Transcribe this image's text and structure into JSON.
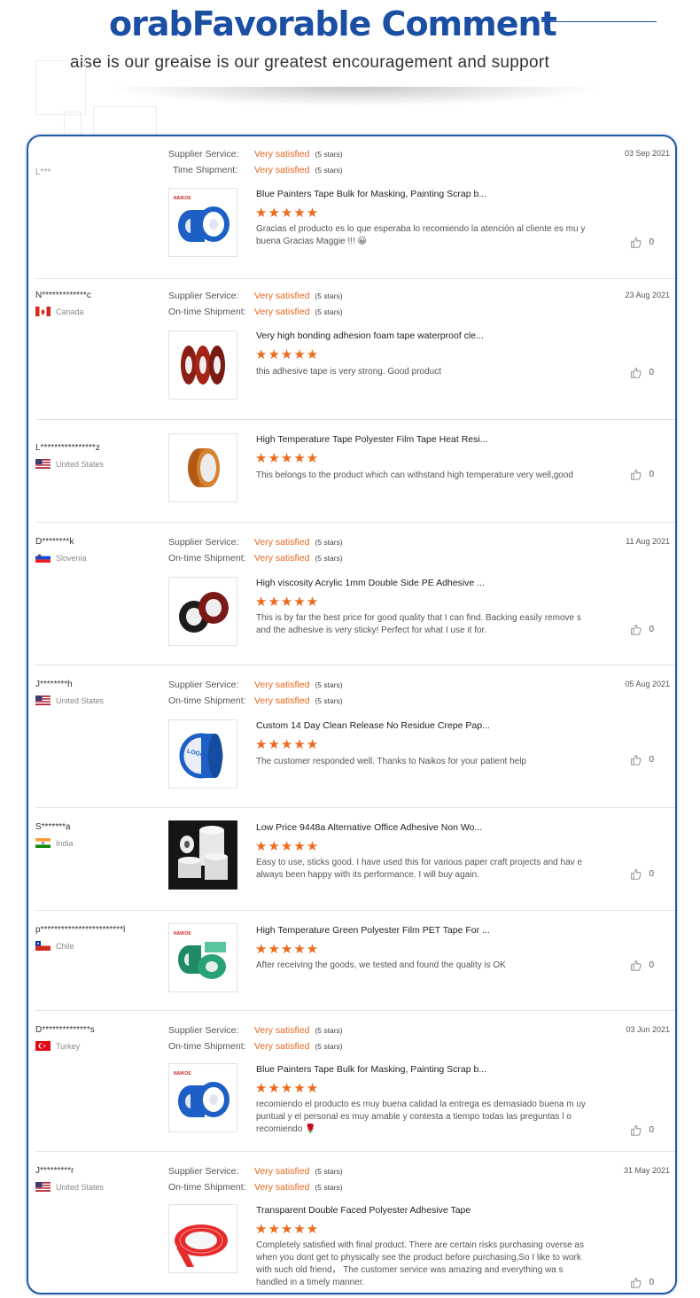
{
  "header": {
    "title": "orabFavorable Comment",
    "subtitle": "aise is our greaise is our greatest encouragement and support"
  },
  "labels": {
    "supplier_service": "Supplier Service:",
    "ontime_shipment": "On-time Shipment:",
    "ontime_shipment_partial": "Time Shipment:",
    "satisfied": "Very satisfied",
    "five_stars": "(5 stars)",
    "stars_glyph": "★★★★★"
  },
  "colors": {
    "accent_blue": "#1a4fa3",
    "star_orange": "#ec6a1e",
    "satisfied_orange": "#e8661d"
  },
  "reviews": [
    {
      "name": "L***",
      "country": "",
      "flag": "none",
      "date": "03 Sep 2021",
      "product": "Blue Painters Tape Bulk for Masking, Painting Scrap b...",
      "text": "Gracias el producto es lo que esperaba lo recomiendo la atención al cliente es mu y buena Gracias Maggie !!! 😀",
      "likes": "0",
      "thumb": "blue-tape"
    },
    {
      "name": "N*************c",
      "country": "Canada",
      "flag": "canada",
      "date": "23 Aug 2021",
      "product": "Very high bonding adhesion foam tape waterproof cle...",
      "text": "this adhesive tape is very strong. Good product",
      "likes": "0",
      "thumb": "red-foam-tape"
    },
    {
      "name": "L****************z",
      "country": "United States",
      "flag": "usa",
      "date": "",
      "product": "High Temperature Tape Polyester Film Tape Heat Resi...",
      "text": "This belongs to the product which can withstand high temperature very well,good",
      "likes": "0",
      "thumb": "kapton-tape"
    },
    {
      "name": "D********k",
      "country": "Slovenia",
      "flag": "slovenia",
      "date": "11 Aug 2021",
      "product": "High viscosity Acrylic 1mm Double Side PE Adhesive ...",
      "text": "This is by far the best price for good quality that I can find. Backing easily remove s and the adhesive is very sticky! Perfect for what I use it for.",
      "likes": "0",
      "thumb": "black-foam-tape"
    },
    {
      "name": "J********h",
      "country": "United States",
      "flag": "usa",
      "date": "05 Aug 2021",
      "product": "Custom 14 Day Clean Release No Residue Crepe Pap...",
      "text": "The customer responded well. Thanks to Naikos for your patient help",
      "likes": "0",
      "thumb": "logo-blue-tape"
    },
    {
      "name": "S*******a",
      "country": "India",
      "flag": "india",
      "date": "",
      "product": "Low Price 9448a Alternative Office Adhesive Non Wo...",
      "text": "Easy to use, sticks good. I have used this for various paper craft projects and hav e always been happy with its performance. I will buy again.",
      "likes": "0",
      "thumb": "white-rolls"
    },
    {
      "name": "p************************l",
      "country": "Chile",
      "flag": "chile",
      "date": "",
      "product": "High Temperature Green Polyester Film PET Tape For ...",
      "text": "After receiving the goods, we tested and found the quality is OK",
      "likes": "0",
      "thumb": "green-tape"
    },
    {
      "name": "D**************s",
      "country": "Turkey",
      "flag": "turkey",
      "date": "03 Jun 2021",
      "product": "Blue Painters Tape Bulk for Masking, Painting Scrap b...",
      "text": "recomiendo el producto es muy buena calidad la entrega es demasiado buena m uy puntual y el personal es muy amable y contesta a tiempo todas las preguntas l o recomiendo 🌹",
      "likes": "0",
      "thumb": "blue-tape"
    },
    {
      "name": "J*********r",
      "country": "United States",
      "flag": "usa",
      "date": "31 May 2021",
      "product": "Transparent Double Faced Polyester Adhesive Tape",
      "text": "Completely satisfied with final product. There are certain risks purchasing overse as when you dont get to physically see the product before purchasing,So I like to work with such old friend， The customer service was amazing and everything wa s handled in a timely manner.",
      "likes": "0",
      "thumb": "red-clear-tape"
    }
  ]
}
